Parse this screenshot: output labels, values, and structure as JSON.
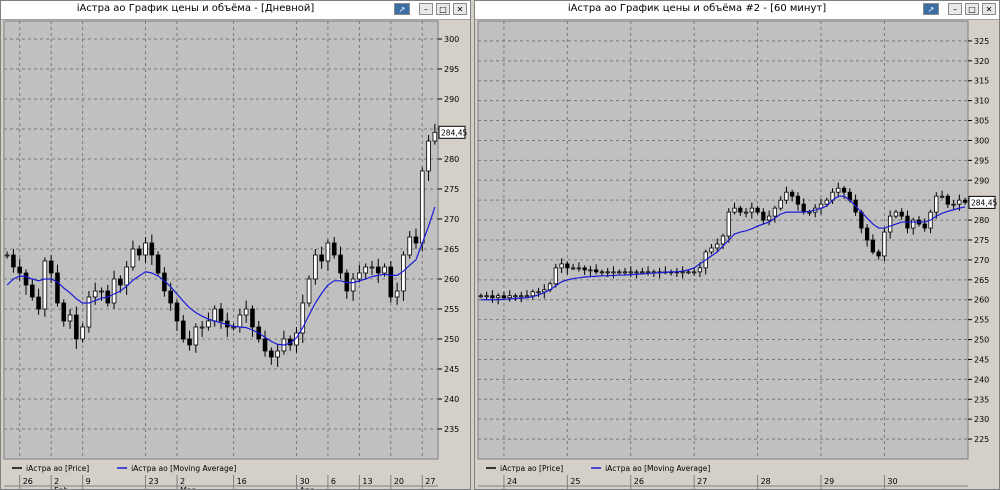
{
  "windows": [
    {
      "title": "iАстра ао График цены и объёма - [Дневной]",
      "buttons": [
        "pin-icon",
        "minimize-icon",
        "maximize-icon",
        "close-icon"
      ],
      "price_marker": "284,45",
      "legend": [
        {
          "label": "iАстра ао [Price]",
          "color": "#000000"
        },
        {
          "label": "iАстра ао [Moving Average]",
          "color": "#1a1ad8"
        }
      ],
      "chart_data": {
        "type": "candlestick",
        "ylim": [
          230,
          303
        ],
        "yticks": [
          235,
          240,
          245,
          250,
          255,
          260,
          265,
          270,
          275,
          280,
          285,
          290,
          295,
          300
        ],
        "xticks": [
          {
            "label": "26",
            "i": 2
          },
          {
            "label": "2",
            "i": 7
          },
          {
            "label": "9",
            "i": 12
          },
          {
            "label": "23",
            "i": 22
          },
          {
            "label": "2",
            "i": 27
          },
          {
            "label": "16",
            "i": 36
          },
          {
            "label": "30",
            "i": 46
          },
          {
            "label": "6",
            "i": 51
          },
          {
            "label": "13",
            "i": 56
          },
          {
            "label": "20",
            "i": 61
          },
          {
            "label": "27",
            "i": 66
          }
        ],
        "month_labels": [
          {
            "label": "Feb",
            "i": 7
          },
          {
            "label": "Mar",
            "i": 27
          },
          {
            "label": "Apr",
            "i": 46
          }
        ],
        "close": [
          264,
          262,
          261,
          259,
          257,
          255,
          263,
          261,
          256,
          253,
          254,
          250,
          252,
          257,
          258,
          258,
          256,
          260,
          259,
          262,
          265,
          264,
          266,
          264,
          261,
          258,
          256,
          253,
          250,
          249,
          252,
          252,
          253,
          255,
          253,
          252,
          252,
          254,
          255,
          252,
          250,
          248,
          247,
          248,
          250,
          249,
          251,
          256,
          260,
          264,
          263,
          266,
          264,
          261,
          258,
          260,
          261,
          262,
          262,
          261,
          262,
          257,
          258,
          264,
          267,
          266,
          278,
          283,
          284.45
        ],
        "ma": [
          259,
          260,
          260.5,
          260.4,
          260,
          259.7,
          260,
          260,
          259.5,
          258.5,
          257.7,
          256.7,
          256,
          256,
          256.4,
          256.8,
          257,
          257.5,
          258,
          258.8,
          259.8,
          260.5,
          261.2,
          261,
          260.5,
          259.7,
          258.7,
          257.5,
          256.3,
          255.2,
          254.4,
          253.8,
          253.3,
          253,
          252.7,
          252.4,
          252.1,
          252,
          251.9,
          251.5,
          251,
          250.3,
          249.6,
          249.1,
          249,
          249.3,
          250.2,
          251.9,
          254,
          256,
          257.6,
          259,
          259.7,
          259.7,
          259.4,
          259.4,
          259.7,
          260,
          260.4,
          260.6,
          260.8,
          260.6,
          260.6,
          261.3,
          262.3,
          263.2,
          266,
          268.8,
          272
        ]
      }
    },
    {
      "title": "iАстра ао График цены и объёма #2 - [60 минут]",
      "buttons": [
        "pin-icon",
        "minimize-icon",
        "maximize-icon",
        "close-icon"
      ],
      "price_marker": "284,45",
      "legend": [
        {
          "label": "iАстра ао [Price]",
          "color": "#000000"
        },
        {
          "label": "iАстра ао [Moving Average]",
          "color": "#1a1ad8"
        }
      ],
      "chart_data": {
        "type": "candlestick",
        "ylim": [
          220,
          330
        ],
        "yticks": [
          225,
          230,
          235,
          240,
          245,
          250,
          255,
          260,
          265,
          270,
          275,
          280,
          285,
          290,
          295,
          300,
          305,
          310,
          315,
          320,
          325
        ],
        "xticks": [
          {
            "label": "24",
            "i": 4
          },
          {
            "label": "25",
            "i": 15
          },
          {
            "label": "26",
            "i": 26
          },
          {
            "label": "27",
            "i": 37
          },
          {
            "label": "28",
            "i": 48
          },
          {
            "label": "29",
            "i": 59
          },
          {
            "label": "30",
            "i": 70
          }
        ],
        "month_labels": [],
        "close": [
          261,
          261,
          260.5,
          261,
          260.5,
          261,
          261,
          261,
          261,
          262,
          262,
          262.5,
          264,
          268,
          269,
          268,
          268,
          268,
          267.5,
          267.5,
          267,
          267,
          267,
          267,
          267,
          267,
          267,
          267,
          267,
          267,
          267,
          267,
          267,
          267,
          267,
          267,
          267,
          267,
          268,
          272,
          273,
          274,
          276,
          282,
          283,
          282,
          282,
          283,
          282,
          280,
          281,
          283,
          285,
          287,
          286,
          284,
          282,
          282,
          283,
          284,
          285,
          287,
          288,
          287,
          285,
          282,
          278,
          275,
          272,
          271,
          277,
          281,
          282,
          281,
          278,
          280,
          279,
          278,
          282,
          286,
          286,
          284,
          284,
          285,
          284.45
        ],
        "ma": [
          260,
          260,
          260,
          260,
          260.1,
          260.2,
          260.3,
          260.4,
          260.5,
          260.8,
          261.2,
          261.8,
          262.5,
          263.5,
          264.5,
          265,
          265.3,
          265.5,
          265.7,
          265.8,
          265.9,
          266,
          266,
          266.1,
          266.2,
          266.2,
          266.3,
          266.4,
          266.5,
          266.6,
          266.7,
          266.8,
          266.9,
          267,
          267,
          267.2,
          267.5,
          268,
          269,
          270,
          271,
          272,
          273.5,
          275,
          276.5,
          277,
          277.3,
          277.8,
          278.5,
          279,
          279.5,
          280.5,
          281.5,
          282,
          282,
          282,
          282,
          282.2,
          282.5,
          283,
          283.5,
          285,
          286,
          286,
          285,
          283.5,
          282,
          280.5,
          279,
          278,
          278,
          278.5,
          279,
          279.5,
          279.5,
          279.5,
          279.5,
          279.5,
          280,
          281,
          281.7,
          282.2,
          282.6,
          283,
          283.3
        ]
      }
    }
  ]
}
